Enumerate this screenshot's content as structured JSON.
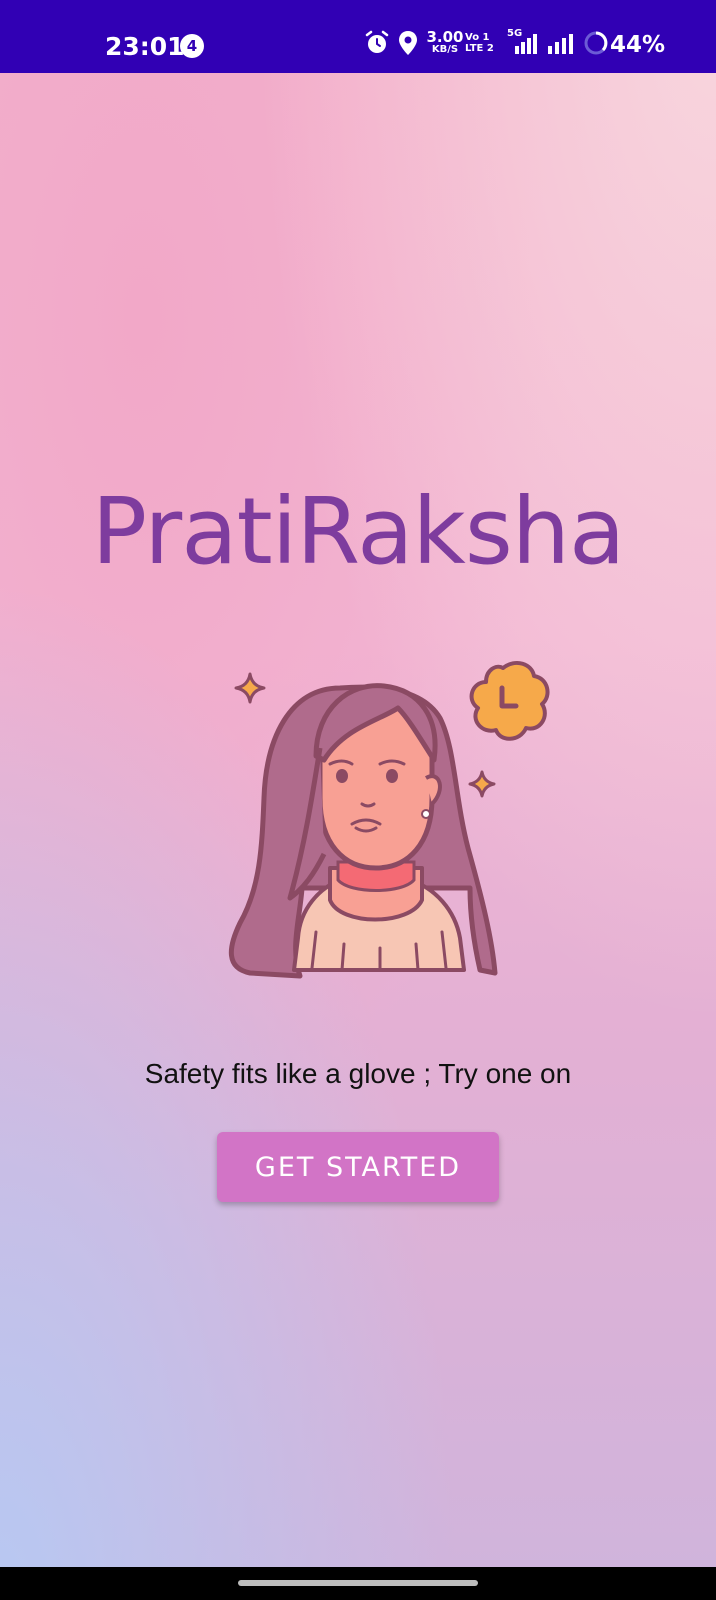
{
  "status_bar": {
    "time": "23:01",
    "notification_count": "4",
    "network_speed_value": "3.00",
    "network_speed_unit": "KB/S",
    "volte_line1": "Vo 1",
    "volte_line2": "LTE 2",
    "network_type": "5G",
    "battery": "44%",
    "background_color": "#3100b4",
    "icons": [
      "alarm-icon",
      "location-icon",
      "signal-icon",
      "signal-icon",
      "battery-saver-icon"
    ]
  },
  "app": {
    "title": "PratiRaksha",
    "title_color": "#7e3c9e",
    "tagline": "Safety fits like a glove ; Try one on",
    "illustration": "woman-avatar-illustration",
    "cta_label": "GET STARTED",
    "cta_color": "#d274c6"
  },
  "nav_bar": {
    "handle": "home-gesture-pill"
  }
}
